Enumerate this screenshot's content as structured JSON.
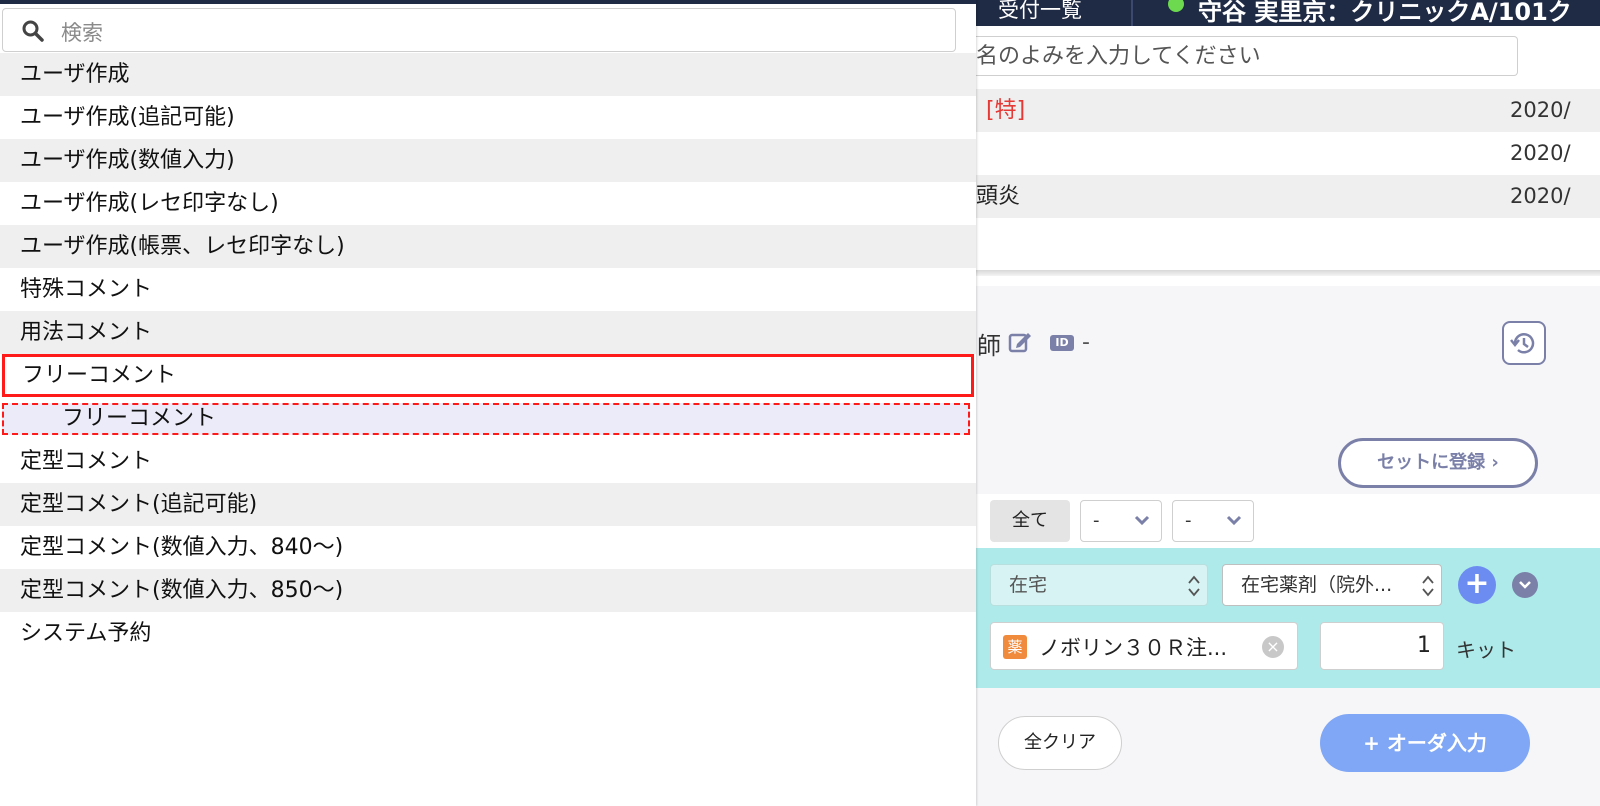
{
  "topbar": {
    "left_text": "受付一覧",
    "right_text": "守谷 実里京：クリニックA/101ク",
    "status_color": "#6cd94f"
  },
  "patient_search": {
    "placeholder": "名のよみを入力してください"
  },
  "history_rows": [
    {
      "title": "[特]",
      "date": "2020/"
    },
    {
      "title": "",
      "date": "2020/"
    },
    {
      "title": "頭炎",
      "date": "2020/"
    }
  ],
  "doctor": {
    "label": "師",
    "id_badge": "ID",
    "id_value": "-"
  },
  "buttons": {
    "register_set": "セットに登録 ›",
    "clear_all": "全クリア",
    "order_input": "+ オーダ入力"
  },
  "filters": {
    "all": "全て",
    "select1": "-",
    "select2": "-"
  },
  "order": {
    "category": "在宅",
    "drug_type": "在宅薬剤（院外...",
    "drug_badge": "薬",
    "drug_name": "ノボリン３０Ｒ注...",
    "quantity": "1",
    "unit": "キット"
  },
  "dropdown": {
    "search_placeholder": "検索",
    "items": [
      "ユーザ作成",
      "ユーザ作成(追記可能)",
      "ユーザ作成(数値入力)",
      "ユーザ作成(レセ印字なし)",
      "ユーザ作成(帳票、レセ印字なし)",
      "特殊コメント",
      "用法コメント",
      "フリーコメント",
      "フリーコメント",
      "定型コメント",
      "定型コメント(追記可能)",
      "定型コメント(数値入力、840〜)",
      "定型コメント(数値入力、850〜)",
      "システム予約"
    ],
    "highlight_color": "#ff1a1a"
  }
}
